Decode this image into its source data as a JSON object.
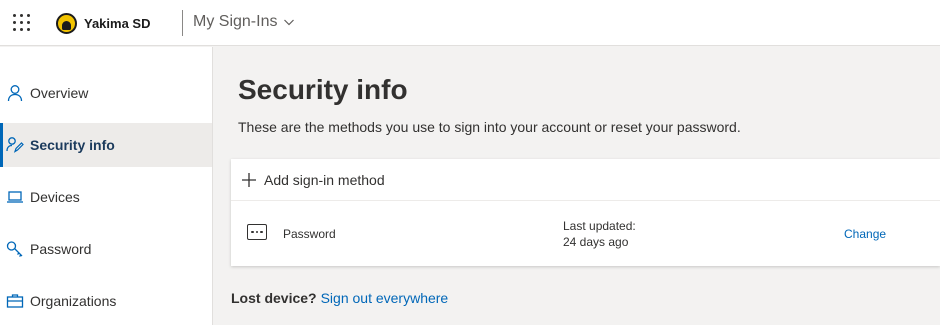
{
  "header": {
    "org_name": "Yakima SD",
    "app_title": "My Sign-Ins"
  },
  "sidebar": {
    "items": [
      {
        "label": "Overview",
        "icon": "person-icon"
      },
      {
        "label": "Security info",
        "icon": "security-info-icon",
        "active": true
      },
      {
        "label": "Devices",
        "icon": "laptop-icon"
      },
      {
        "label": "Password",
        "icon": "key-icon"
      },
      {
        "label": "Organizations",
        "icon": "briefcase-icon"
      }
    ]
  },
  "main": {
    "title": "Security info",
    "subtitle": "These are the methods you use to sign into your account or reset your password.",
    "add_method_label": "Add sign-in method",
    "methods": [
      {
        "name": "Password",
        "icon": "password-dots-icon",
        "last_updated_label": "Last updated:",
        "last_updated_value": "24 days ago",
        "action_label": "Change"
      }
    ],
    "lost_device_question": "Lost device?",
    "sign_out_link": "Sign out everywhere"
  },
  "colors": {
    "accent": "#0067b8",
    "nav_active_bg": "#edebe9",
    "page_bg": "#f3f2f1",
    "logo_yellow": "#f2c300"
  }
}
